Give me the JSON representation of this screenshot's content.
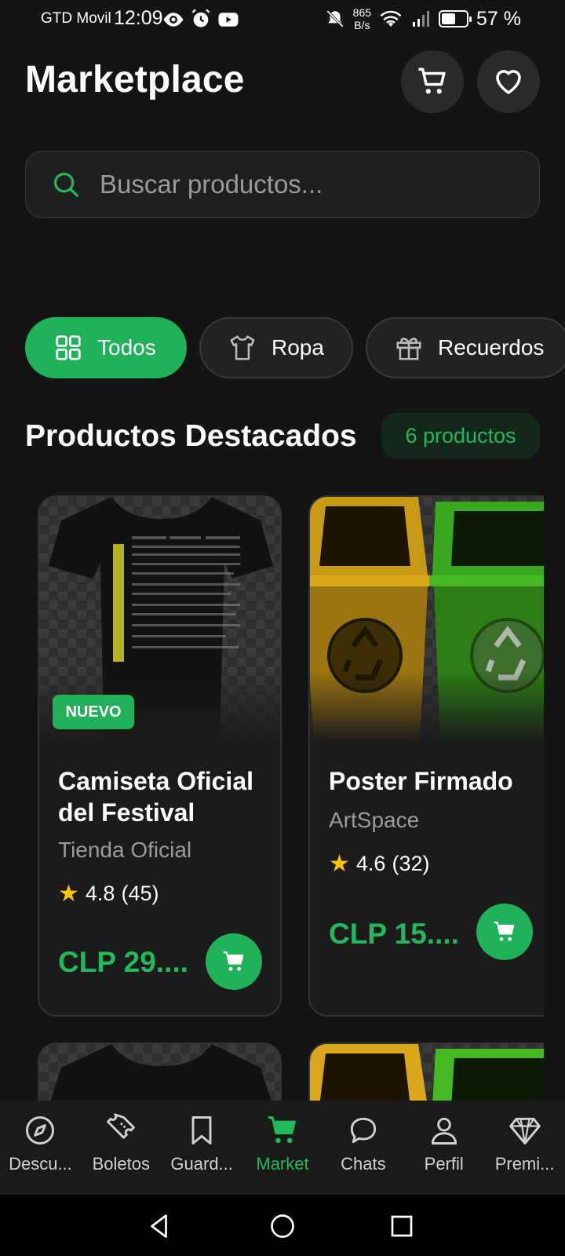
{
  "status_bar": {
    "carrier": "GTD Movil",
    "time": "12:09",
    "net_speed_value": "865",
    "net_speed_unit": "B/s",
    "battery": "57 %"
  },
  "header": {
    "title": "Marketplace"
  },
  "search": {
    "placeholder": "Buscar productos..."
  },
  "categories": [
    {
      "label": "Todos",
      "icon": "grid-icon",
      "active": true
    },
    {
      "label": "Ropa",
      "icon": "tshirt-icon",
      "active": false
    },
    {
      "label": "Recuerdos",
      "icon": "gift-icon",
      "active": false
    }
  ],
  "section": {
    "title": "Productos Destacados",
    "count_label": "6 productos"
  },
  "products": [
    {
      "badge": "NUEVO",
      "name": "Camiseta Oficial del Festival",
      "seller": "Tienda Oficial",
      "rating": "4.8",
      "reviews": "(45)",
      "price": "CLP 29....",
      "image": "tshirt-image"
    },
    {
      "name": "Poster Firmado",
      "seller": "ArtSpace",
      "rating": "4.6",
      "reviews": "(32)",
      "price": "CLP 15....",
      "image": "recycle-bins-image"
    }
  ],
  "bottom_nav": [
    {
      "label": "Descu...",
      "icon": "compass-icon",
      "active": false
    },
    {
      "label": "Boletos",
      "icon": "ticket-icon",
      "active": false
    },
    {
      "label": "Guard...",
      "icon": "bookmark-icon",
      "active": false
    },
    {
      "label": "Market",
      "icon": "cart-icon",
      "active": true
    },
    {
      "label": "Chats",
      "icon": "chat-icon",
      "active": false
    },
    {
      "label": "Perfil",
      "icon": "person-icon",
      "active": false
    },
    {
      "label": "Premi...",
      "icon": "diamond-icon",
      "active": false
    }
  ],
  "colors": {
    "background": "#141414",
    "accent": "#21b159",
    "accent_text": "#22b95c",
    "star": "#ffc400"
  }
}
